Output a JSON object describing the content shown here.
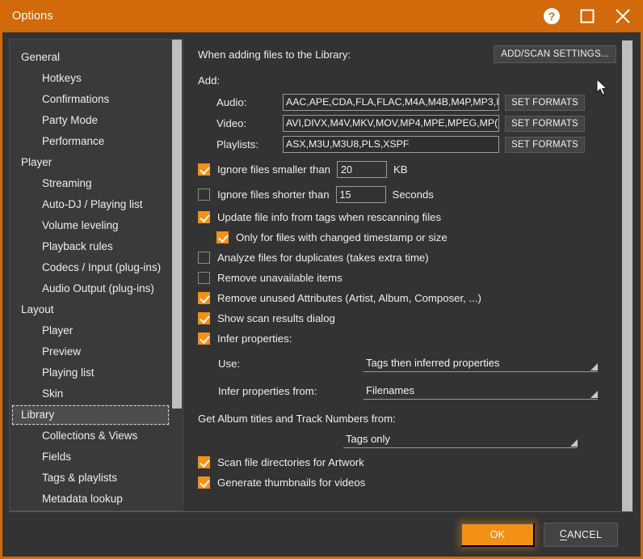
{
  "window": {
    "title": "Options",
    "controls": [
      {
        "name": "help-icon",
        "glyph": "?"
      },
      {
        "name": "maximize-icon",
        "glyph": "□"
      },
      {
        "name": "close-icon",
        "glyph": "✕"
      }
    ],
    "accent_color": "#d2690a",
    "checkbox_on_color": "#f39016",
    "background_color": "#333333"
  },
  "sidebar": {
    "items": [
      {
        "label": "General",
        "type": "group",
        "selected": false
      },
      {
        "label": "Hotkeys",
        "type": "item",
        "selected": false
      },
      {
        "label": "Confirmations",
        "type": "item",
        "selected": false
      },
      {
        "label": "Party Mode",
        "type": "item",
        "selected": false
      },
      {
        "label": "Performance",
        "type": "item",
        "selected": false
      },
      {
        "label": "Player",
        "type": "group",
        "selected": false
      },
      {
        "label": "Streaming",
        "type": "item",
        "selected": false
      },
      {
        "label": "Auto-DJ / Playing list",
        "type": "item",
        "selected": false
      },
      {
        "label": "Volume leveling",
        "type": "item",
        "selected": false
      },
      {
        "label": "Playback rules",
        "type": "item",
        "selected": false
      },
      {
        "label": "Codecs / Input (plug-ins)",
        "type": "item",
        "selected": false
      },
      {
        "label": "Audio Output (plug-ins)",
        "type": "item",
        "selected": false
      },
      {
        "label": "Layout",
        "type": "group",
        "selected": false
      },
      {
        "label": "Player",
        "type": "item",
        "selected": false
      },
      {
        "label": "Preview",
        "type": "item",
        "selected": false
      },
      {
        "label": "Playing list",
        "type": "item",
        "selected": false
      },
      {
        "label": "Skin",
        "type": "item",
        "selected": false
      },
      {
        "label": "Library",
        "type": "group",
        "selected": true
      },
      {
        "label": "Collections & Views",
        "type": "item",
        "selected": false
      },
      {
        "label": "Fields",
        "type": "item",
        "selected": false
      },
      {
        "label": "Tags & playlists",
        "type": "item",
        "selected": false
      },
      {
        "label": "Metadata lookup",
        "type": "item",
        "selected": false
      }
    ]
  },
  "content": {
    "header_label": "When adding files to the Library:",
    "add_scan_settings_button": "ADD/SCAN SETTINGS...",
    "add_label": "Add:",
    "formats": [
      {
        "label": "Audio:",
        "value": "AAC,APE,CDA,FLA,FLAC,M4A,M4B,M4P,MP3,I",
        "button": "SET FORMATS"
      },
      {
        "label": "Video:",
        "value": "AVI,DIVX,M4V,MKV,MOV,MP4,MPE,MPEG,MP(",
        "button": "SET FORMATS"
      },
      {
        "label": "Playlists:",
        "value": "ASX,M3U,M3U8,PLS,XSPF",
        "button": "SET FORMATS"
      }
    ],
    "ignore_smaller": {
      "label": "Ignore files smaller than",
      "checked": true,
      "value": "20",
      "unit": "KB"
    },
    "ignore_shorter": {
      "label": "Ignore files shorter than",
      "checked": false,
      "value": "15",
      "unit": "Seconds"
    },
    "checkboxes": [
      {
        "label": "Update file info from tags when rescanning files",
        "checked": true,
        "indent": 0
      },
      {
        "label": "Only for files with changed timestamp or size",
        "checked": true,
        "indent": 1
      },
      {
        "label": "Analyze files for duplicates (takes extra time)",
        "checked": false,
        "indent": 0
      },
      {
        "label": "Remove unavailable items",
        "checked": false,
        "indent": 0
      },
      {
        "label": "Remove unused Attributes (Artist, Album, Composer, ...)",
        "checked": true,
        "indent": 0
      },
      {
        "label": "Show scan results dialog",
        "checked": true,
        "indent": 0
      },
      {
        "label": "Infer properties:",
        "checked": true,
        "indent": 0
      }
    ],
    "use_dropdown": {
      "label": "Use:",
      "value": "Tags then inferred properties"
    },
    "infer_from_dropdown": {
      "label": "Infer properties from:",
      "value": "Filenames"
    },
    "album_label": "Get Album titles and Track Numbers from:",
    "album_dropdown": {
      "value": "Tags only"
    },
    "bottom_checkboxes": [
      {
        "label": "Scan file directories for Artwork",
        "checked": true
      },
      {
        "label": "Generate thumbnails for videos",
        "checked": true
      }
    ]
  },
  "footer": {
    "ok_label": "OK",
    "cancel_label_pre": "",
    "cancel_label_accel": "C",
    "cancel_label_post": "ANCEL"
  }
}
